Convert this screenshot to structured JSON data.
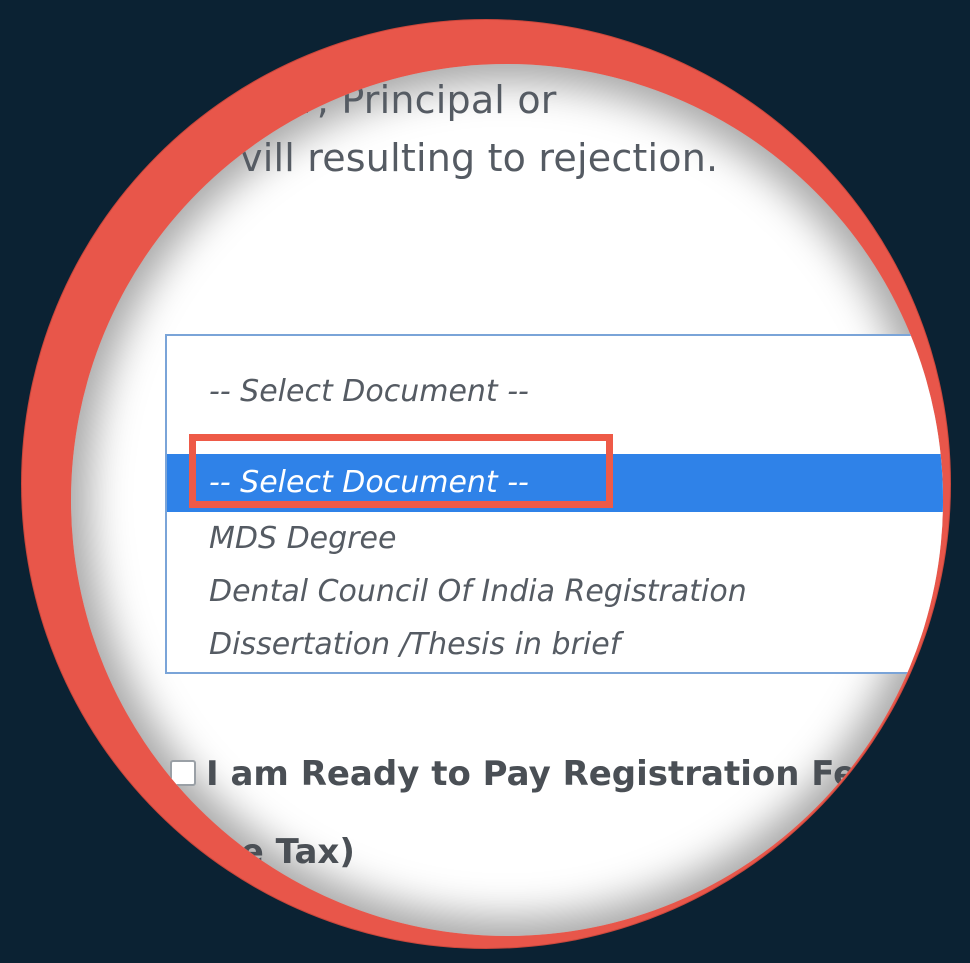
{
  "intro_text": {
    "line1": "ncer, Principal or",
    "line2": "vill resulting to rejection."
  },
  "document_select": {
    "current_value": "-- Select Document --",
    "options": [
      {
        "label": "-- Select Document --",
        "selected": true
      },
      {
        "label": "MDS Degree",
        "selected": false
      },
      {
        "label": "Dental Council Of India Registration",
        "selected": false
      },
      {
        "label": "Dissertation /Thesis in brief",
        "selected": false
      }
    ]
  },
  "fee_checkbox": {
    "checked": false,
    "label_line1": "I am Ready to Pay Registration Fee. I",
    "label_line2": "rvice Tax)"
  },
  "colors": {
    "background": "#0b2233",
    "lens_ring": "#e8564a",
    "highlight_box": "#ee5a47",
    "selected_option": "#2f82e8"
  }
}
